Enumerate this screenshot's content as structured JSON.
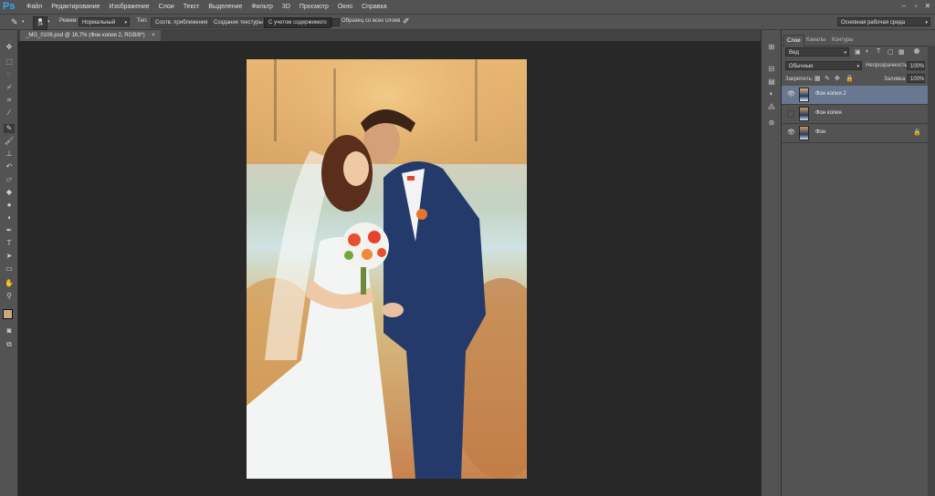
{
  "app": {
    "logo": "Ps"
  },
  "menu": [
    "Файл",
    "Редактирование",
    "Изображение",
    "Слои",
    "Текст",
    "Выделение",
    "Фильтр",
    "3D",
    "Просмотр",
    "Окно",
    "Справка"
  ],
  "options": {
    "brush_size": "34",
    "mode_label": "Режим:",
    "mode_value": "Нормальный",
    "type_label": "Тип:",
    "type_buttons": [
      "Соотв. приближения",
      "Создание текстуры",
      "С учетом содержимого"
    ],
    "sample_all_label": "Образец со всех слоев",
    "workspace": "Основная рабочая среда"
  },
  "document": {
    "tab_title": "_MG_0106.psd @ 16,7% (Фон копия 2, RGB/8*)",
    "tab_close": "×"
  },
  "layers_panel": {
    "tabs": [
      "Слои",
      "Каналы",
      "Контуры"
    ],
    "active_tab": "Слои",
    "filter_kind": "Вид",
    "blend_mode": "Обычные",
    "opacity_label": "Непрозрачность:",
    "opacity_value": "100%",
    "lock_label": "Закрепить:",
    "fill_label": "Заливка:",
    "fill_value": "100%",
    "layers": [
      {
        "name": "Фон копия 2",
        "visible": true,
        "selected": true,
        "locked": false
      },
      {
        "name": "Фон копия",
        "visible": false,
        "selected": false,
        "locked": false
      },
      {
        "name": "Фон",
        "visible": true,
        "selected": false,
        "locked": true
      }
    ]
  },
  "colors": {
    "ui_panel": "#535353",
    "canvas_bg": "#282828",
    "selected_layer": "#687891",
    "foreground_swatch": "#c9a882",
    "background_swatch": "#000000"
  }
}
